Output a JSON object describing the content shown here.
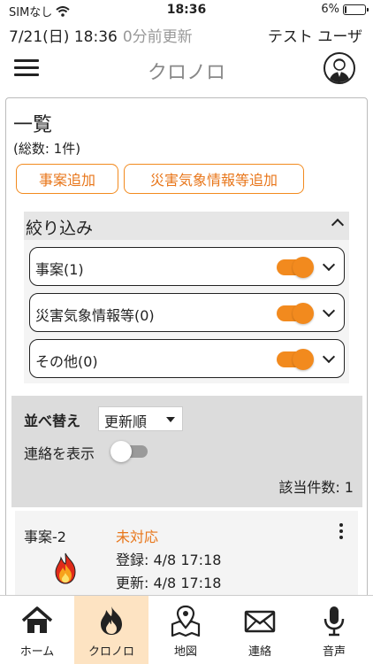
{
  "status_bar": {
    "carrier": "SIMなし",
    "time": "18:36",
    "battery": "6%",
    "battery_level": 0.06
  },
  "info": {
    "datetime": "7/21(日) 18:36",
    "updated": "0分前更新",
    "user": "テスト ユーザ"
  },
  "header": {
    "title": "クロノロ"
  },
  "list": {
    "title": "一覧",
    "total": "(総数: 1件)",
    "add_incident_label": "事案追加",
    "add_weather_label": "災害気象情報等追加"
  },
  "filter": {
    "title": "絞り込み",
    "rows": [
      {
        "label": "事案(1)",
        "on": true
      },
      {
        "label": "災害気象情報等(0)",
        "on": true
      },
      {
        "label": "その他(0)",
        "on": true
      }
    ]
  },
  "sort": {
    "label": "並べ替え",
    "selected": "更新順",
    "contact_label": "連絡を表示",
    "contact_on": false,
    "count": "該当件数: 1"
  },
  "items": [
    {
      "name": "事案-2",
      "status": "未対応",
      "registered": "登録: 4/8 17:18",
      "updated": "更新: 4/8 17:18",
      "icon": "fire-icon"
    }
  ],
  "nav": [
    {
      "label": "ホーム",
      "icon": "home-icon"
    },
    {
      "label": "クロノロ",
      "icon": "flame-icon",
      "active": true
    },
    {
      "label": "地図",
      "icon": "map-icon"
    },
    {
      "label": "連絡",
      "icon": "mail-icon"
    },
    {
      "label": "音声",
      "icon": "mic-icon"
    }
  ],
  "colors": {
    "accent": "#f28a1e",
    "active_nav_bg": "#fde3c2",
    "status_text": "#e8761a"
  }
}
